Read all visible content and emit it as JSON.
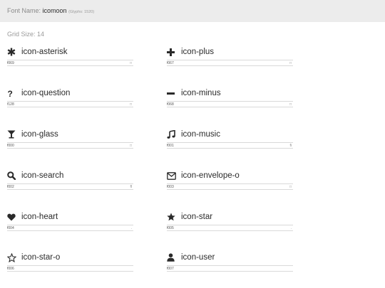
{
  "header": {
    "label": "Font Name:",
    "font_name": "icomoon",
    "glyph_count": "(Glyphs: 1520)"
  },
  "grid_size": "Grid Size: 14",
  "glyphs": [
    {
      "name": "icon-asterisk",
      "code": "f069",
      "char": "□",
      "icon": "asterisk-icon"
    },
    {
      "name": "icon-plus",
      "code": "f067",
      "char": "□",
      "icon": "plus-icon"
    },
    {
      "name": "icon-question",
      "code": "f128",
      "char": "□",
      "icon": "question-icon"
    },
    {
      "name": "icon-minus",
      "code": "f068",
      "char": "□",
      "icon": "minus-icon"
    },
    {
      "name": "icon-glass",
      "code": "f000",
      "char": "□",
      "icon": "glass-icon"
    },
    {
      "name": "icon-music",
      "code": "f001",
      "char": "fi",
      "icon": "music-icon"
    },
    {
      "name": "icon-search",
      "code": "f002",
      "char": "fl",
      "icon": "search-icon"
    },
    {
      "name": "icon-envelope-o",
      "code": "f003",
      "char": "□",
      "icon": "envelope-o-icon"
    },
    {
      "name": "icon-heart",
      "code": "f004",
      "char": ".",
      "icon": "heart-icon"
    },
    {
      "name": "icon-star",
      "code": "f005",
      "char": ".",
      "icon": "star-icon"
    },
    {
      "name": "icon-star-o",
      "code": "f006",
      "char": "",
      "icon": "star-o-icon"
    },
    {
      "name": "icon-user",
      "code": "f007",
      "char": "",
      "icon": "user-icon"
    }
  ]
}
